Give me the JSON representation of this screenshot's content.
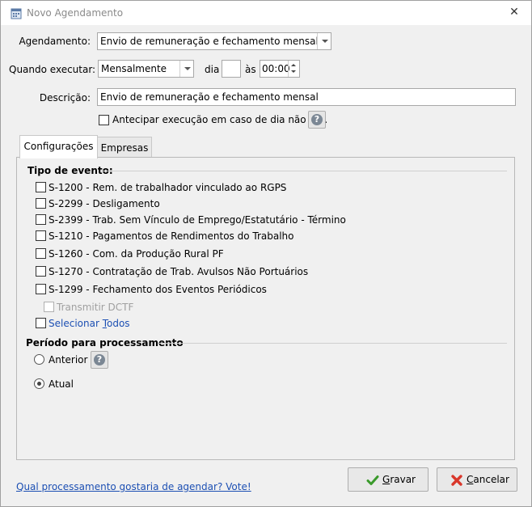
{
  "window": {
    "title": "Novo Agendamento"
  },
  "form": {
    "agendamento_label": "Agendamento:",
    "agendamento_value": "Envio de remuneração e fechamento mensal",
    "quando_label": "Quando executar:",
    "quando_value": "Mensalmente",
    "dia_label": "dia",
    "dia_value": "",
    "as_label": "às",
    "hora_value": "00:00",
    "descricao_label": "Descrição:",
    "descricao_value": "Envio de remuneração e fechamento mensal",
    "antecipar_label": "Antecipar execução em caso de dia não útil.",
    "antecipar_checked": false
  },
  "tabs": [
    {
      "label": "Configurações",
      "active": true
    },
    {
      "label": "Empresas",
      "active": false
    }
  ],
  "config": {
    "tipo_evento_title": "Tipo de evento:",
    "events": [
      {
        "label": "S-1200 - Rem. de trabalhador vinculado ao RGPS",
        "checked": false
      },
      {
        "label": "S-2299 - Desligamento",
        "checked": false
      },
      {
        "label": "S-2399 - Trab. Sem Vínculo de Emprego/Estatutário - Término",
        "checked": false
      },
      {
        "label": "S-1210 - Pagamentos de Rendimentos do Trabalho",
        "checked": false
      },
      {
        "label": "S-1260 - Com. da Produção Rural PF",
        "checked": false
      },
      {
        "label": "S-1270 - Contratação de Trab. Avulsos Não Portuários",
        "checked": false
      },
      {
        "label": "S-1299 - Fechamento dos Eventos Periódicos",
        "checked": false
      }
    ],
    "transmitir_dctf_label": "Transmitir DCTF",
    "selecionar_prefix": "Selecionar ",
    "selecionar_accel": "T",
    "selecionar_suffix": "odos",
    "periodo_title": "Período para processamento",
    "anterior_label": "Anterior",
    "atual_label": "Atual",
    "selected_period": "Atual"
  },
  "footer": {
    "vote_link": "Qual processamento gostaria de agendar? Vote!",
    "gravar_accel": "G",
    "gravar_rest": "ravar",
    "cancelar_accel": "C",
    "cancelar_rest": "ancelar"
  },
  "colors": {
    "link": "#1c4fb3",
    "ok_check": "#3a9a2b",
    "cancel_x": "#d9372b"
  }
}
